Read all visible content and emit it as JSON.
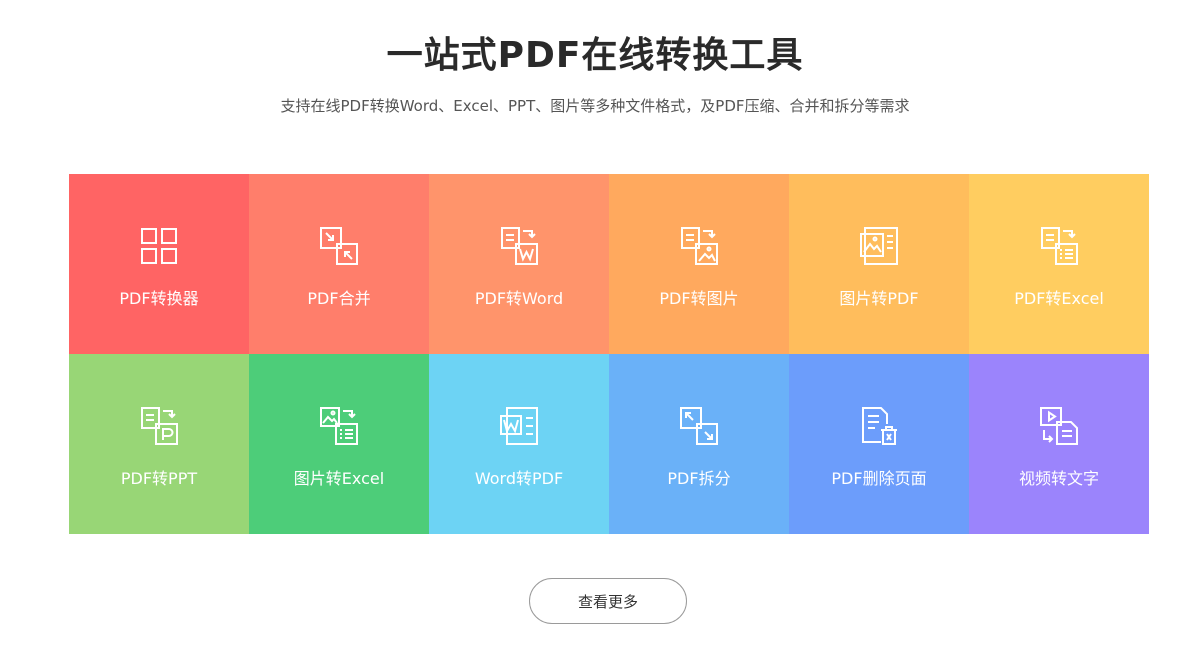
{
  "header": {
    "title": "一站式PDF在线转换工具",
    "subtitle": "支持在线PDF转换Word、Excel、PPT、图片等多种文件格式，及PDF压缩、合并和拆分等需求"
  },
  "tools": [
    {
      "label": "PDF转换器",
      "color": "#FF6464",
      "icon": "grid-icon"
    },
    {
      "label": "PDF合并",
      "color": "#FF7E6B",
      "icon": "merge-icon"
    },
    {
      "label": "PDF转Word",
      "color": "#FF946B",
      "icon": "pdf-to-word-icon"
    },
    {
      "label": "PDF转图片",
      "color": "#FFA95E",
      "icon": "pdf-to-image-icon"
    },
    {
      "label": "图片转PDF",
      "color": "#FFBD5C",
      "icon": "image-to-pdf-icon"
    },
    {
      "label": "PDF转Excel",
      "color": "#FFCD60",
      "icon": "pdf-to-excel-icon"
    },
    {
      "label": "PDF转PPT",
      "color": "#98D676",
      "icon": "pdf-to-ppt-icon"
    },
    {
      "label": "图片转Excel",
      "color": "#4DCD79",
      "icon": "image-to-excel-icon"
    },
    {
      "label": "Word转PDF",
      "color": "#6DD3F4",
      "icon": "word-to-pdf-icon"
    },
    {
      "label": "PDF拆分",
      "color": "#6AB1F8",
      "icon": "split-icon"
    },
    {
      "label": "PDF删除页面",
      "color": "#6C9DFB",
      "icon": "delete-pages-icon"
    },
    {
      "label": "视频转文字",
      "color": "#9B84FC",
      "icon": "video-to-text-icon"
    }
  ],
  "more_button": {
    "label": "查看更多"
  }
}
